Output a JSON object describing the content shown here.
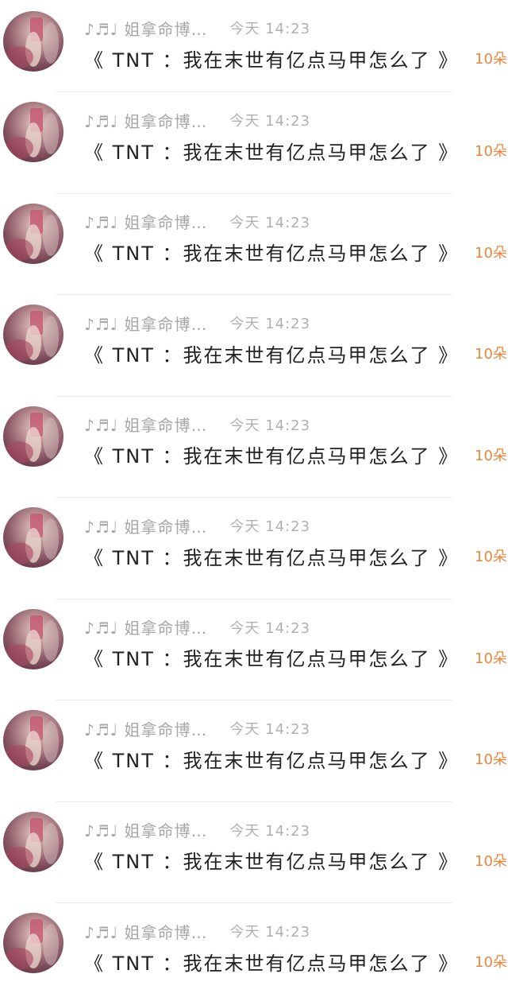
{
  "colors": {
    "sender": "#a7a7a7",
    "message": "#222222",
    "flowers": "#f0843a",
    "divider": "#ececec"
  },
  "messages": [
    {
      "sender": "♪♬♩ 姐拿命博…",
      "time": "今天 14:23",
      "text": "《 TNT ：我在末世有亿点马甲怎么了 》",
      "flowers": "10朵",
      "avatar_icon": "avatar-photo"
    },
    {
      "sender": "♪♬♩ 姐拿命博…",
      "time": "今天 14:23",
      "text": "《 TNT ：我在末世有亿点马甲怎么了 》",
      "flowers": "10朵",
      "avatar_icon": "avatar-photo"
    },
    {
      "sender": "♪♬♩ 姐拿命博…",
      "time": "今天 14:23",
      "text": "《 TNT ：我在末世有亿点马甲怎么了 》",
      "flowers": "10朵",
      "avatar_icon": "avatar-photo"
    },
    {
      "sender": "♪♬♩ 姐拿命博…",
      "time": "今天 14:23",
      "text": "《 TNT ：我在末世有亿点马甲怎么了 》",
      "flowers": "10朵",
      "avatar_icon": "avatar-photo"
    },
    {
      "sender": "♪♬♩ 姐拿命博…",
      "time": "今天 14:23",
      "text": "《 TNT ：我在末世有亿点马甲怎么了 》",
      "flowers": "10朵",
      "avatar_icon": "avatar-photo"
    },
    {
      "sender": "♪♬♩ 姐拿命博…",
      "time": "今天 14:23",
      "text": "《 TNT ：我在末世有亿点马甲怎么了 》",
      "flowers": "10朵",
      "avatar_icon": "avatar-photo"
    },
    {
      "sender": "♪♬♩ 姐拿命博…",
      "time": "今天 14:23",
      "text": "《 TNT ：我在末世有亿点马甲怎么了 》",
      "flowers": "10朵",
      "avatar_icon": "avatar-photo"
    },
    {
      "sender": "♪♬♩ 姐拿命博…",
      "time": "今天 14:23",
      "text": "《 TNT ：我在末世有亿点马甲怎么了 》",
      "flowers": "10朵",
      "avatar_icon": "avatar-photo"
    },
    {
      "sender": "♪♬♩ 姐拿命博…",
      "time": "今天 14:23",
      "text": "《 TNT ：我在末世有亿点马甲怎么了 》",
      "flowers": "10朵",
      "avatar_icon": "avatar-photo"
    },
    {
      "sender": "♪♬♩ 姐拿命博…",
      "time": "今天 14:23",
      "text": "《 TNT ：我在末世有亿点马甲怎么了 》",
      "flowers": "10朵",
      "avatar_icon": "avatar-photo"
    }
  ]
}
